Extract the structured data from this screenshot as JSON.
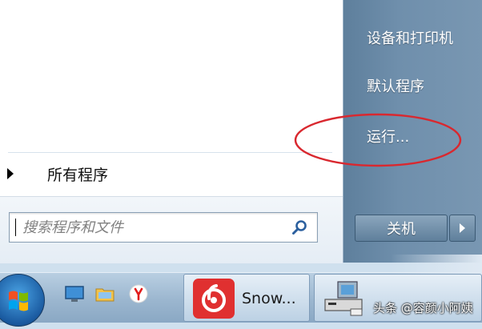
{
  "start_menu": {
    "all_programs_label": "所有程序",
    "search_placeholder": "搜索程序和文件",
    "right_items": [
      "设备和打印机",
      "默认程序",
      "运行..."
    ],
    "shutdown_label": "关机"
  },
  "taskbar": {
    "running_app_label": "Snow..."
  },
  "watermark": "头条 @容颜小阿姨",
  "colors": {
    "annotation": "#d9282f",
    "right_panel": "#6f8fac",
    "netease_red": "#e03030"
  }
}
